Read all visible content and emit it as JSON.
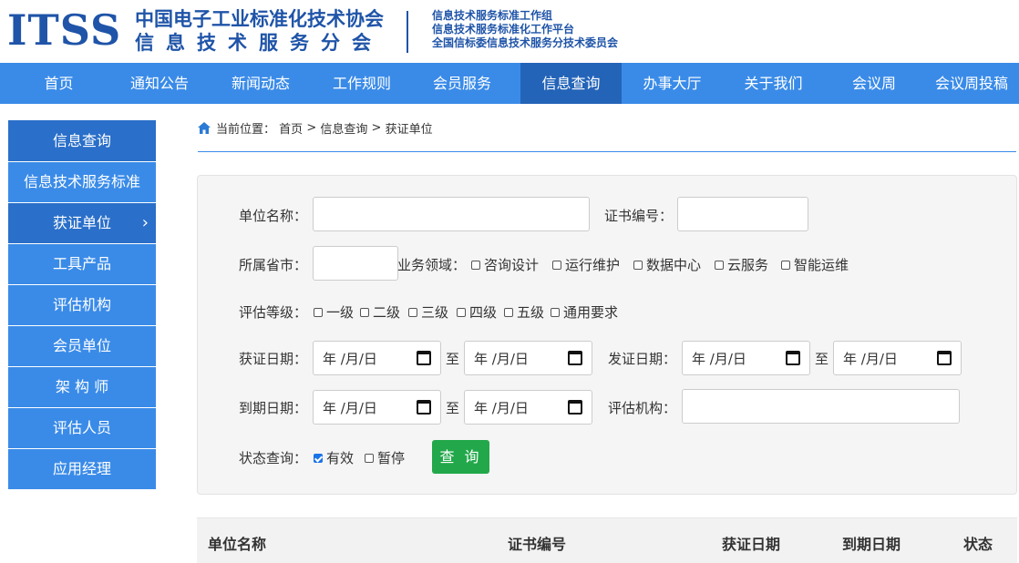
{
  "header": {
    "logo_text": "ITSS",
    "org_line1": "中国电子工业标准化技术协会",
    "org_line2": "信息技术服务分会",
    "right_lines": [
      "信息技术服务标准工作组",
      "信息技术服务标准化工作平台",
      "全国信标委信息技术服务分技术委员会"
    ]
  },
  "nav": {
    "items": [
      "首页",
      "通知公告",
      "新闻动态",
      "工作规则",
      "会员服务",
      "信息查询",
      "办事大厅",
      "关于我们",
      "会议周",
      "会议周投稿"
    ],
    "active": "信息查询"
  },
  "sidebar": {
    "title": "信息查询",
    "items": [
      "信息技术服务标准",
      "获证单位",
      "工具产品",
      "评估机构",
      "会员单位",
      "架 构 师",
      "评估人员",
      "应用经理"
    ],
    "active": "获证单位",
    "active_chevron": "›"
  },
  "breadcrumb": {
    "prefix": "当前位置：",
    "parts": [
      "首页",
      ">",
      "信息查询",
      ">",
      "获证单位"
    ]
  },
  "search": {
    "unit_name_label": "单位名称：",
    "unit_name_value": "",
    "cert_no_label": "证书编号：",
    "cert_no_value": "",
    "province_label": "所属省市：",
    "province_value": "",
    "domain_label": "业务领域：",
    "domains": [
      "咨询设计",
      "运行维护",
      "数据中心",
      "云服务",
      "智能运维"
    ],
    "grade_label": "评估等级：",
    "grades": [
      "一级",
      "二级",
      "三级",
      "四级",
      "五级",
      "通用要求"
    ],
    "cert_date_label": "获证日期：",
    "issue_date_label": "发证日期：",
    "expire_date_label": "到期日期：",
    "date_placeholder": "年 /月/日",
    "to_label": "至",
    "org_label": "评估机构：",
    "org_value": "",
    "status_label": "状态查询：",
    "status_options": [
      {
        "label": "有效",
        "checked": true
      },
      {
        "label": "暂停",
        "checked": false
      }
    ],
    "query_button": "查 询"
  },
  "table": {
    "columns": [
      "单位名称",
      "证书编号",
      "获证日期",
      "到期日期",
      "状态"
    ]
  },
  "colors": {
    "brand_blue": "#1f54a8",
    "nav_blue": "#3a8be8",
    "active_blue": "#2464b8",
    "query_green": "#22a84a"
  }
}
